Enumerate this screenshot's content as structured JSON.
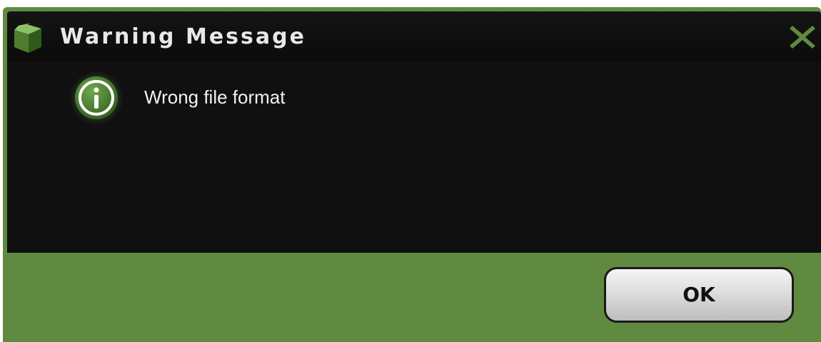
{
  "dialog": {
    "title": "Warning Message",
    "title_icon": "box-icon",
    "close_icon": "close-icon",
    "message_icon": "info-icon",
    "message": "Wrong file format",
    "ok_label": "OK"
  },
  "colors": {
    "frame": "#5f8a3f",
    "titlebar": "#101010",
    "content": "#101010",
    "accent": "#6aa84f",
    "close": "#5f8a3f"
  }
}
